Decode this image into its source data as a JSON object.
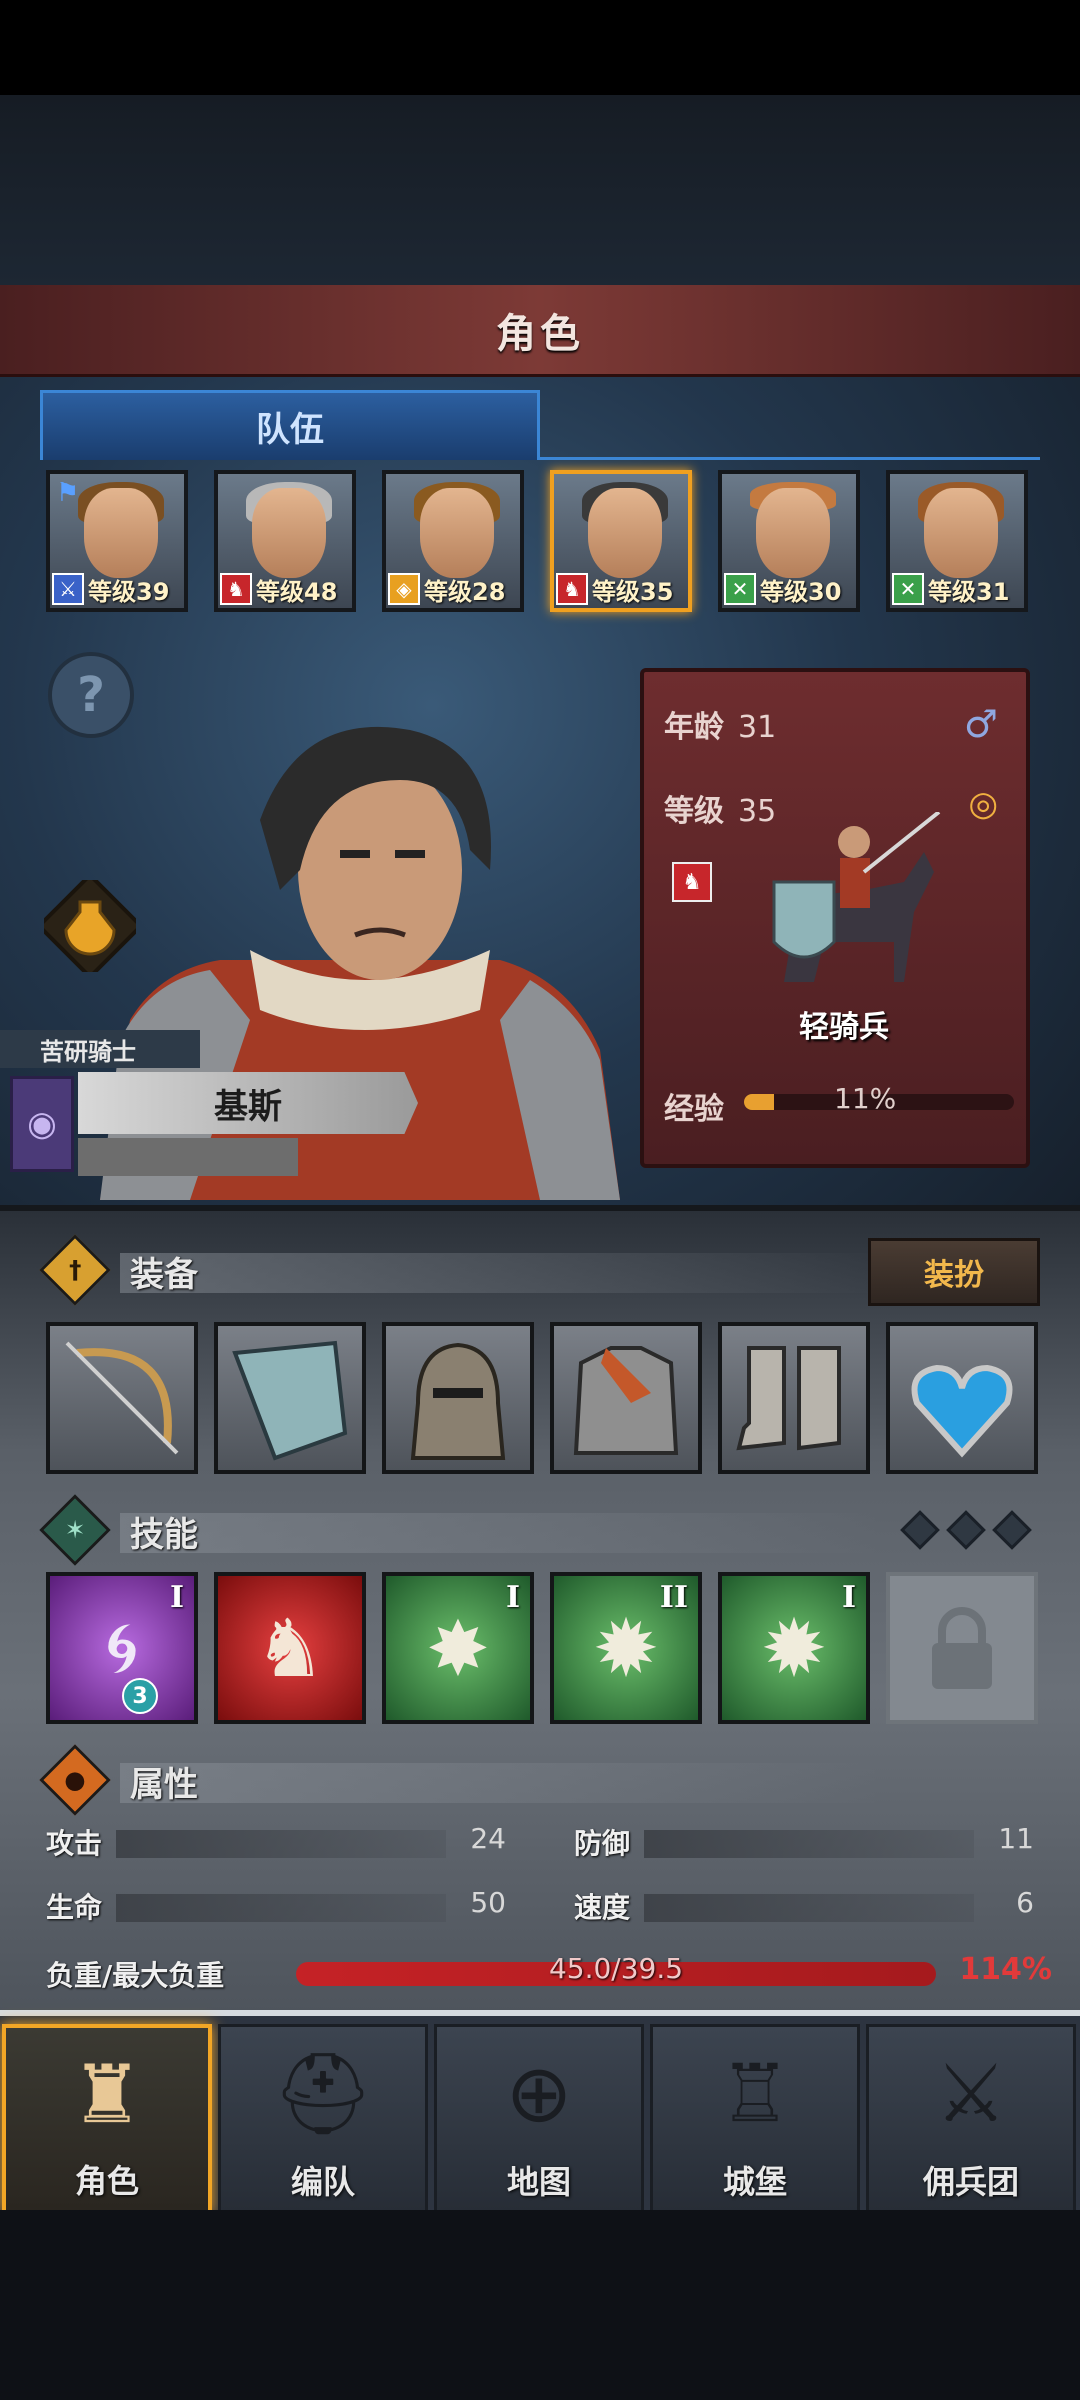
{
  "header": {
    "title": "角色"
  },
  "tabs": {
    "active_label": "队伍"
  },
  "roster": [
    {
      "level_label": "等级39",
      "class_icon": "sword-icon",
      "class_color": "#3a62c8",
      "flag": true
    },
    {
      "level_label": "等级48",
      "class_icon": "horse-icon",
      "class_color": "#c7262b",
      "flag": false
    },
    {
      "level_label": "等级28",
      "class_icon": "shield-icon",
      "class_color": "#e8a020",
      "flag": false
    },
    {
      "level_label": "等级35",
      "class_icon": "horse-icon",
      "class_color": "#c7262b",
      "flag": false,
      "selected": true
    },
    {
      "level_label": "等级30",
      "class_icon": "crossed-swords-icon",
      "class_color": "#3aa04a",
      "flag": false
    },
    {
      "level_label": "等级31",
      "class_icon": "crossed-swords-icon",
      "class_color": "#3aa04a",
      "flag": false
    }
  ],
  "hero": {
    "title": "苦研骑士",
    "name": "基斯",
    "age_label": "年龄",
    "age": "31",
    "level_label": "等级",
    "level": "35",
    "class_name": "轻骑兵",
    "exp_label": "经验",
    "exp_percent_text": "11%",
    "exp_fraction": 0.11
  },
  "equipment": {
    "title": "装备",
    "dress_button": "装扮",
    "slots": [
      "bow-icon",
      "shield-icon",
      "helmet-icon",
      "armor-icon",
      "boots-icon",
      "amulet-icon"
    ]
  },
  "skills": {
    "title": "技能",
    "slots": [
      {
        "icon": "tornado-icon",
        "style": "purple",
        "rank": "I",
        "badge": "3"
      },
      {
        "icon": "horse-charge-icon",
        "style": "red",
        "rank": "",
        "badge": ""
      },
      {
        "icon": "burst-crystal-icon",
        "style": "green",
        "rank": "I",
        "badge": ""
      },
      {
        "icon": "burst-icon",
        "style": "green",
        "rank": "II",
        "badge": ""
      },
      {
        "icon": "burst-icon",
        "style": "green",
        "rank": "I",
        "badge": ""
      },
      {
        "icon": "lock-icon",
        "style": "locked",
        "rank": "",
        "badge": ""
      }
    ]
  },
  "attributes": {
    "title": "属性",
    "attack_label": "攻击",
    "attack": "24",
    "defense_label": "防御",
    "defense": "11",
    "hp_label": "生命",
    "hp": "50",
    "speed_label": "速度",
    "speed": "6",
    "load_label": "负重/最大负重",
    "load_text": "45.0/39.5",
    "load_percent": "114%"
  },
  "nav": {
    "items": [
      {
        "label": "角色",
        "icon": "knight-icon",
        "active": true
      },
      {
        "label": "编队",
        "icon": "helmet-group-icon",
        "active": false
      },
      {
        "label": "地图",
        "icon": "compass-icon",
        "active": false
      },
      {
        "label": "城堡",
        "icon": "castle-icon",
        "active": false
      },
      {
        "label": "佣兵团",
        "icon": "banner-sword-icon",
        "active": false
      }
    ]
  }
}
